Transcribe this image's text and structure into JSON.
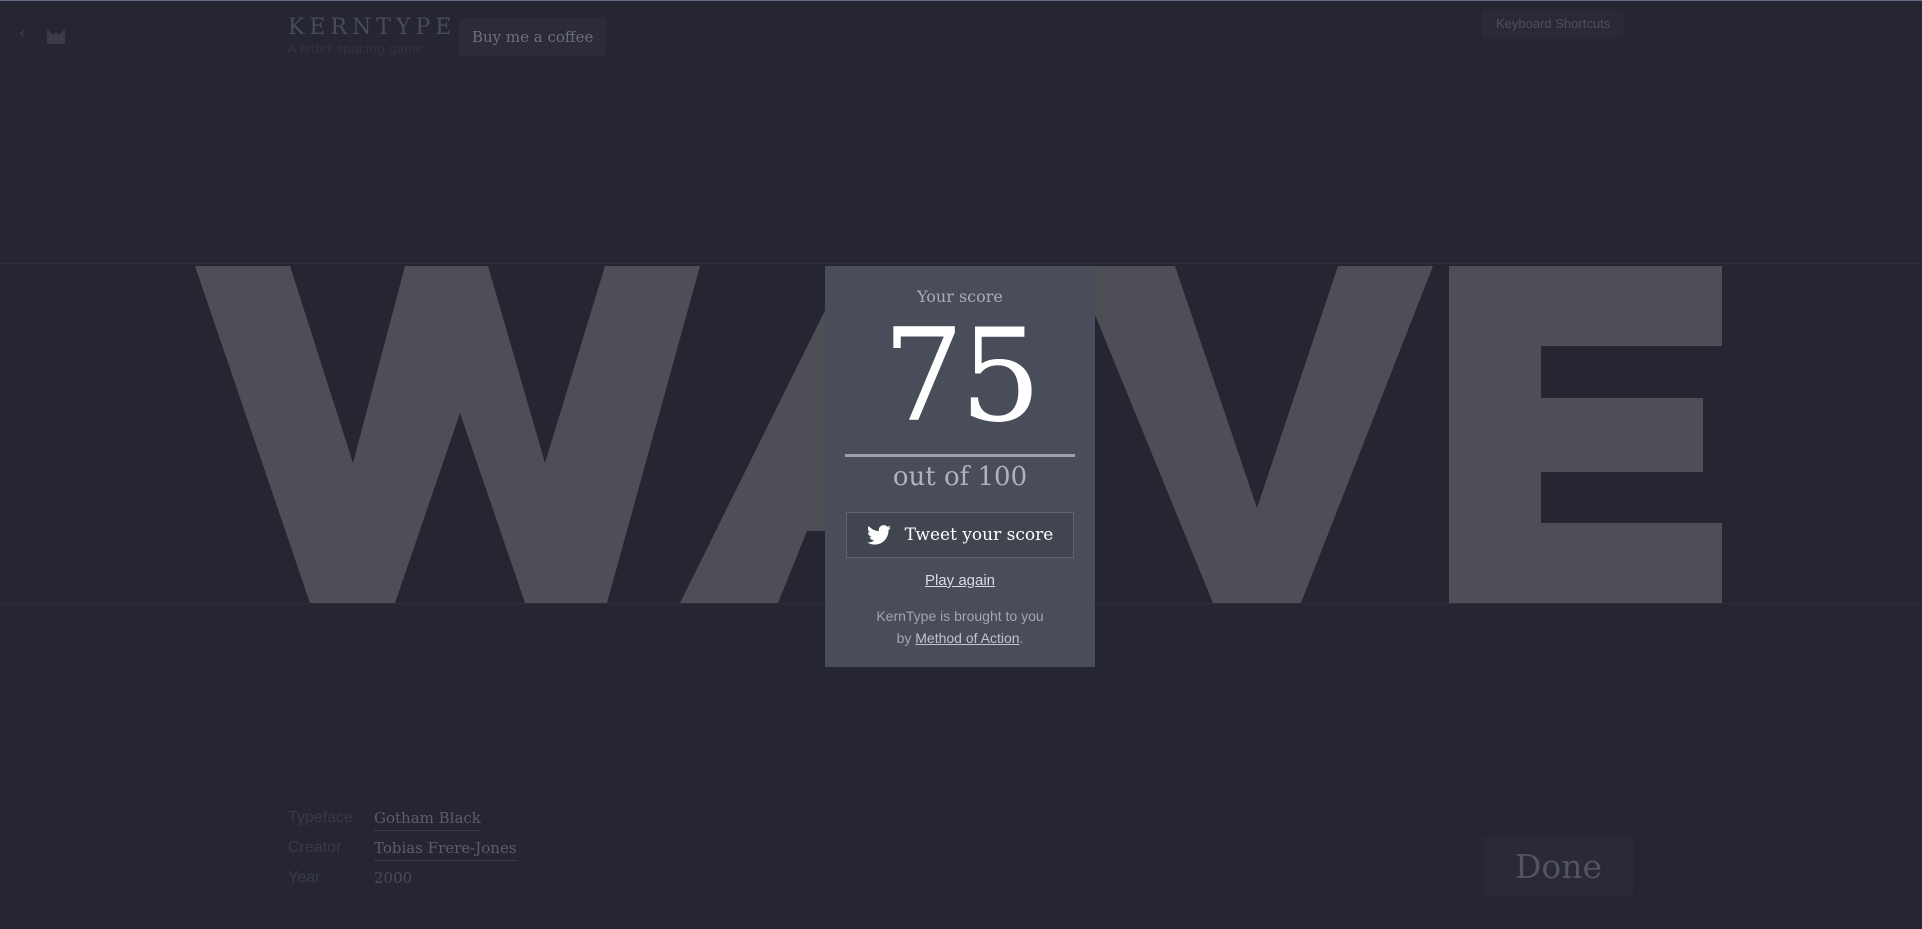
{
  "header": {
    "brand_title": "KERNTYPE",
    "brand_subtitle": "A letter spacing game",
    "coffee_button": "Buy me a coffee",
    "shortcuts_button": "Keyboard Shortcuts"
  },
  "word": {
    "text": "WAVE",
    "letter_color": "#4e4e56"
  },
  "score_modal": {
    "label": "Your score",
    "score": "75",
    "out_of": "out of 100",
    "tweet_label": "Tweet your score",
    "play_again": "Play again",
    "credit_line1": "KernType is brought to you",
    "credit_by": "by ",
    "credit_link": "Method of Action",
    "credit_end": "."
  },
  "font_info": {
    "typeface_label": "Typeface",
    "typeface_value": "Gotham Black",
    "creator_label": "Creator",
    "creator_value": "Tobias Frere-Jones",
    "year_label": "Year",
    "year_value": "2000"
  },
  "done_button": "Done",
  "icons": {
    "back": "chevron-left-icon",
    "logo": "method-of-action-logo-icon",
    "tweet": "twitter-bird-icon"
  }
}
